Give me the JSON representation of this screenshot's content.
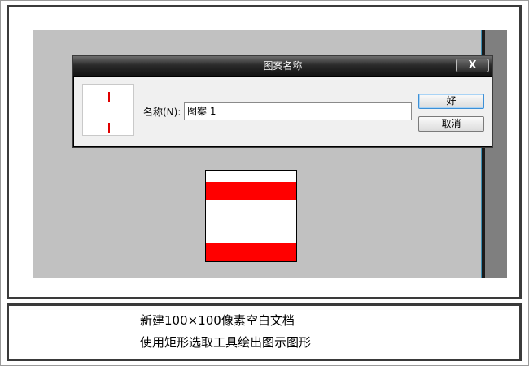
{
  "dialog": {
    "title": "图案名称",
    "close_label": "X",
    "name_label": "名称(N):",
    "name_value": "图案 1",
    "ok_label": "好",
    "cancel_label": "取消"
  },
  "pattern": {
    "stripe_color": "#ff0000",
    "background_color": "#ffffff"
  },
  "caption": {
    "line1": "新建100×100像素空白文档",
    "line2": "使用矩形选取工具绘出图示图形"
  },
  "colors": {
    "workspace": "#c1c1c1",
    "titlebar": "#111111",
    "accent": "#3c8fd6"
  }
}
